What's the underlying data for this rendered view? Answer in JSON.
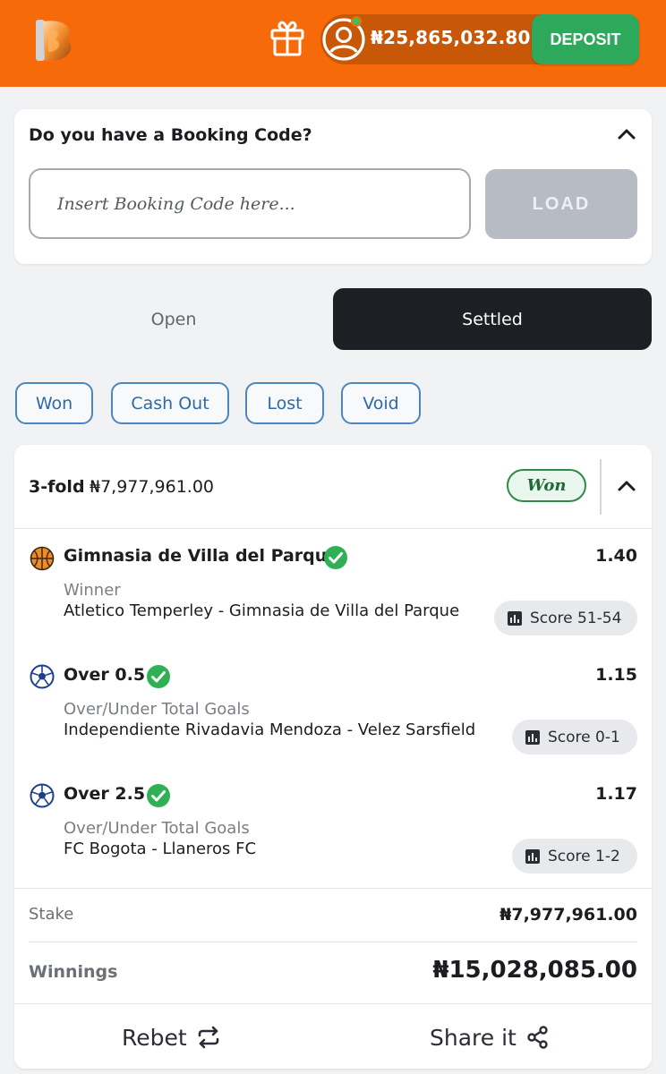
{
  "header": {
    "balance": "₦25,865,032.80",
    "deposit_label": "DEPOSIT",
    "brand_color": "#f76a0a",
    "deposit_color": "#2ea85b"
  },
  "booking": {
    "title": "Do you have a Booking Code?",
    "placeholder": "Insert Booking Code here...",
    "load_label": "LOAD"
  },
  "tabs": [
    {
      "label": "Open",
      "active": false
    },
    {
      "label": "Settled",
      "active": true
    }
  ],
  "filters": [
    "Won",
    "Cash Out",
    "Lost",
    "Void"
  ],
  "bet": {
    "type": "3-fold",
    "stake_header": "₦7,977,961.00",
    "status": "Won",
    "selections": [
      {
        "sport_icon": "basketball-icon",
        "pick": "Gimnasia de Villa del Parque",
        "odds": "1.40",
        "market": "Winner",
        "match": "Atletico Temperley - Gimnasia de Villa del Parque",
        "score": "Score 51-54"
      },
      {
        "sport_icon": "soccer-ball-icon",
        "pick": "Over 0.5",
        "odds": "1.15",
        "market": "Over/Under Total Goals",
        "match": "Independiente Rivadavia Mendoza - Velez Sarsfield",
        "score": "Score 0-1"
      },
      {
        "sport_icon": "soccer-ball-icon",
        "pick": "Over 2.5",
        "odds": "1.17",
        "market": "Over/Under Total Goals",
        "match": "FC Bogota - Llaneros FC",
        "score": "Score 1-2"
      }
    ],
    "stake_label": "Stake",
    "stake_value": "₦7,977,961.00",
    "winnings_label": "Winnings",
    "winnings_value": "₦15,028,085.00",
    "rebet_label": "Rebet",
    "share_label": "Share it"
  }
}
